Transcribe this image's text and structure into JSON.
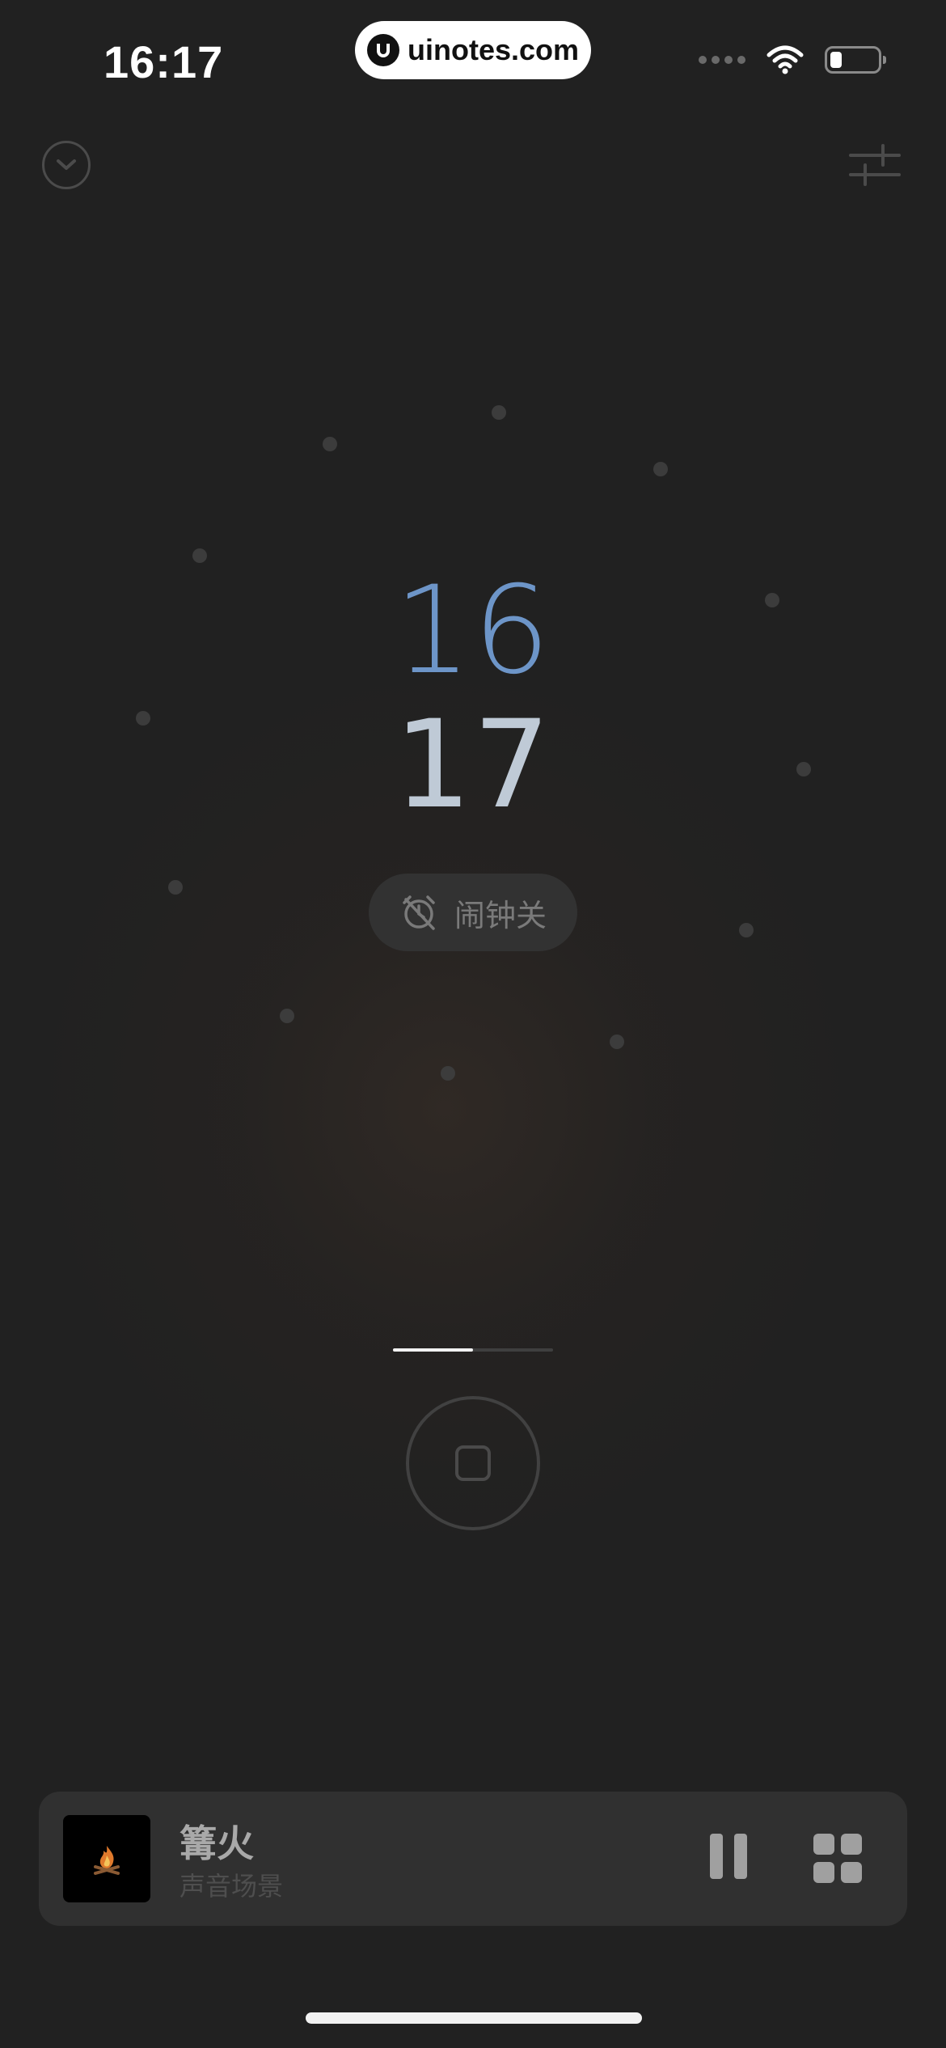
{
  "status_bar": {
    "time": "16:17"
  },
  "watermark": {
    "text": "uinotes.com"
  },
  "clock": {
    "hour": "16",
    "minute": "17"
  },
  "alarm": {
    "label": "闹钟关",
    "icon": "alarm-off-icon"
  },
  "pager": {
    "page": 1,
    "pages": 2
  },
  "player": {
    "title": "篝火",
    "subtitle": "声音场景",
    "icons": [
      "campfire-icon",
      "pause-icon",
      "grid-icon"
    ]
  },
  "icons": {
    "collapse": "chevron-down-icon",
    "settings": "sliders-icon",
    "stop": "stop-icon"
  },
  "colors": {
    "background": "#212121",
    "hour": "#6d95c8",
    "minute": "#bfcad6",
    "player_bg": "#303030"
  }
}
